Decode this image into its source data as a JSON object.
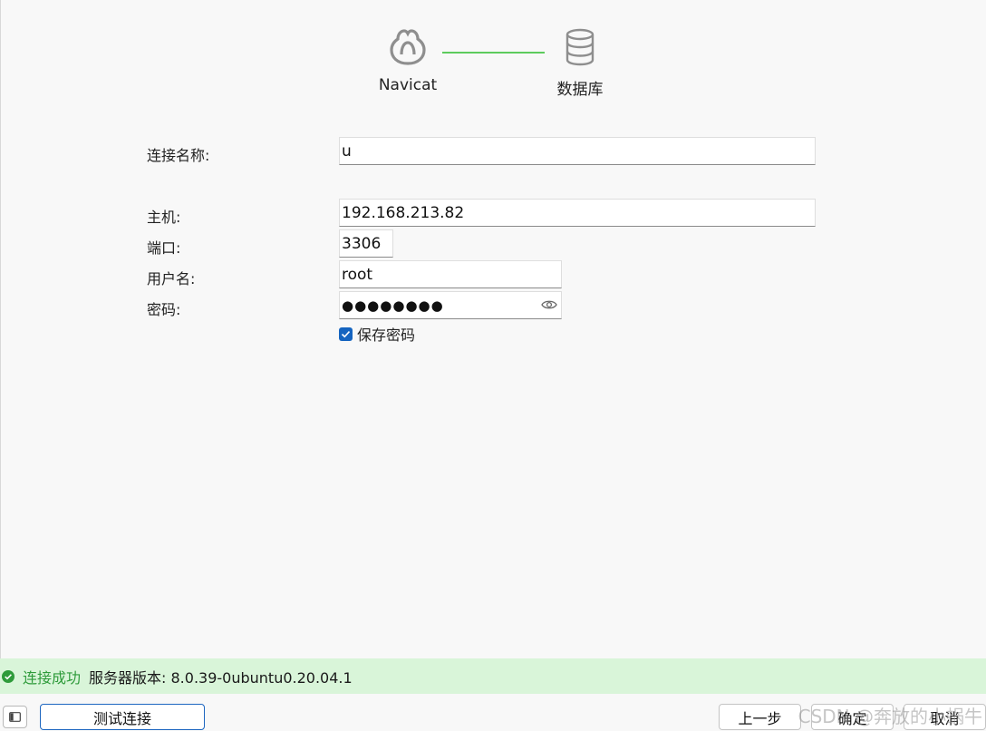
{
  "steps": [
    {
      "label": "Navicat",
      "icon": "navicat-logo-icon"
    },
    {
      "label": "数据库",
      "icon": "database-icon"
    }
  ],
  "accent": {
    "step_line": "#5dcb5d",
    "checkbox": "#1564c0",
    "success": "#2e9b3a",
    "status_bg": "#d9f5d9"
  },
  "form": {
    "connection_name": {
      "label": "连接名称:",
      "value": "u"
    },
    "host": {
      "label": "主机:",
      "value": "192.168.213.82"
    },
    "port": {
      "label": "端口:",
      "value": "3306"
    },
    "username": {
      "label": "用户名:",
      "value": "root"
    },
    "password": {
      "label": "密码:",
      "value": "●●●●●●●●"
    },
    "save_password": {
      "label": "保存密码",
      "checked": true
    }
  },
  "status": {
    "message": "连接成功",
    "version": "服务器版本: 8.0.39-0ubuntu0.20.04.1"
  },
  "footer": {
    "test_button": "测试连接",
    "prev_button": "上一步",
    "ok_button": "确定",
    "cancel_button": "取消"
  },
  "watermark": "CSDN @奔放的小蜗牛"
}
